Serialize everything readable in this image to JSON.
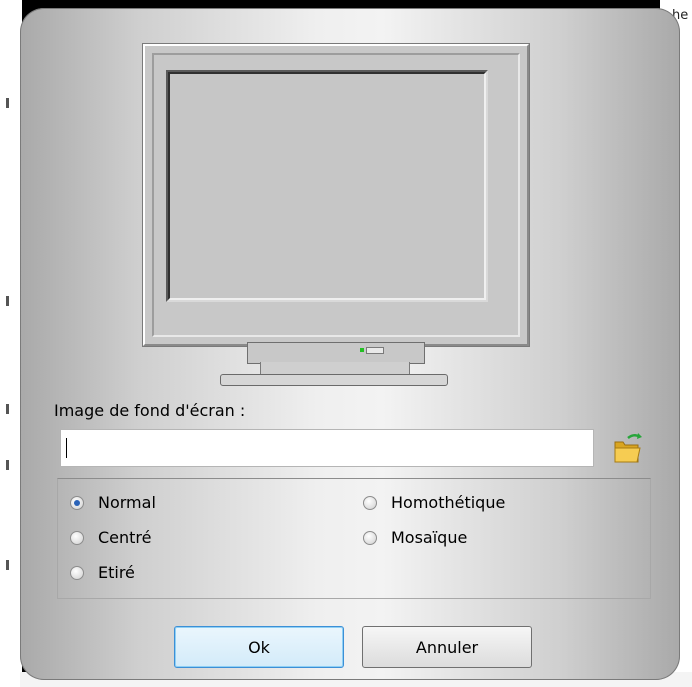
{
  "dialog": {
    "wallpaper_label": "Image de fond d'écran :",
    "path_value": "",
    "options": [
      {
        "label": "Normal",
        "checked": true
      },
      {
        "label": "Centré",
        "checked": false
      },
      {
        "label": "Etiré",
        "checked": false
      },
      {
        "label": "Homothétique",
        "checked": false
      },
      {
        "label": "Mosaïque",
        "checked": false
      }
    ],
    "ok_label": "Ok",
    "cancel_label": "Annuler"
  },
  "background_window": {
    "right_edge_text": [
      "he"
    ]
  },
  "icons": {
    "browse": "folder-open-icon"
  }
}
